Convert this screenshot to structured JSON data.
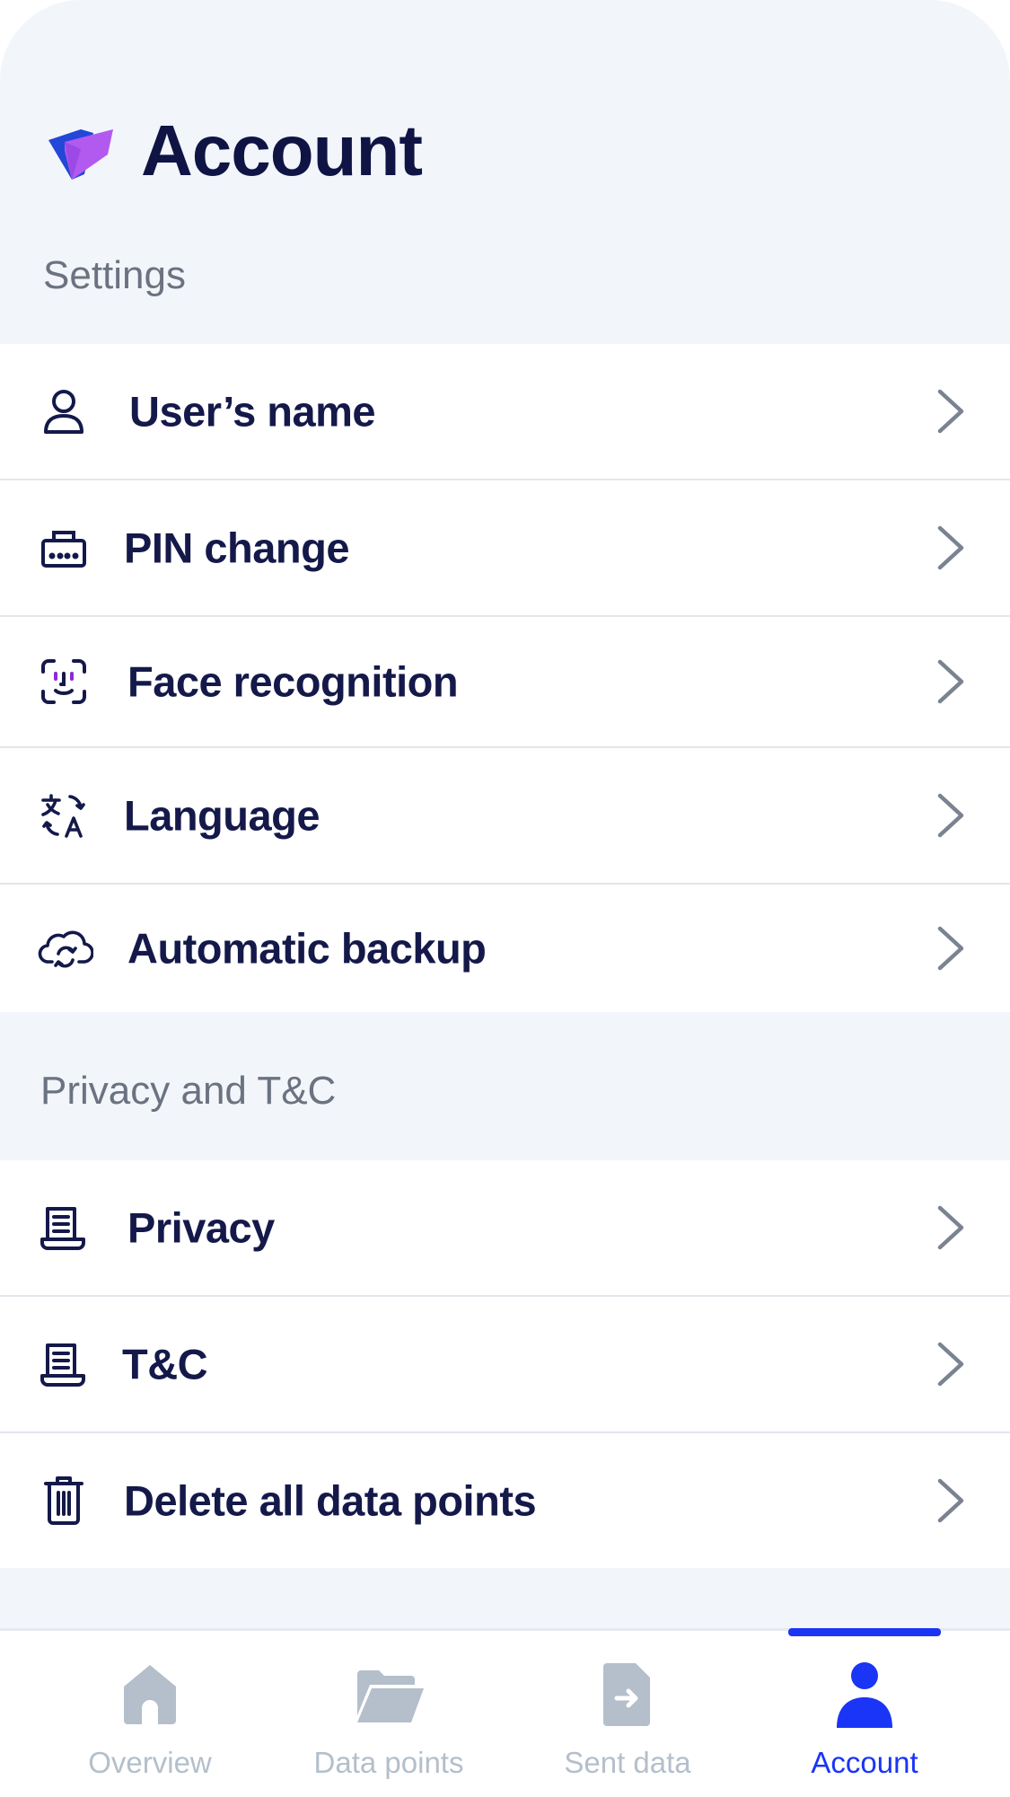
{
  "header": {
    "title": "Account",
    "settings_label": "Settings"
  },
  "settings": {
    "items": [
      {
        "label": "User’s name",
        "icon": "user-icon"
      },
      {
        "label": "PIN change",
        "icon": "keypad-icon"
      },
      {
        "label": "Face recognition",
        "icon": "face-id-icon"
      },
      {
        "label": "Language",
        "icon": "translate-icon"
      },
      {
        "label": "Automatic backup",
        "icon": "cloud-sync-icon"
      }
    ]
  },
  "privacy": {
    "section_label": "Privacy and T&C",
    "items": [
      {
        "label": "Privacy",
        "icon": "document-icon"
      },
      {
        "label": "T&C",
        "icon": "document-icon"
      },
      {
        "label": "Delete all data points",
        "icon": "trash-icon"
      }
    ]
  },
  "tabbar": {
    "tabs": [
      {
        "label": "Overview",
        "icon": "home-icon",
        "active": false
      },
      {
        "label": "Data points",
        "icon": "folder-icon",
        "active": false
      },
      {
        "label": "Sent data",
        "icon": "file-send-icon",
        "active": false
      },
      {
        "label": "Account",
        "icon": "person-icon",
        "active": true
      }
    ]
  },
  "colors": {
    "accent": "#1a35f5",
    "background": "#f2f5fa",
    "text_primary": "#14194a",
    "text_secondary": "#6b7280",
    "tab_inactive": "#b4bfcb"
  }
}
